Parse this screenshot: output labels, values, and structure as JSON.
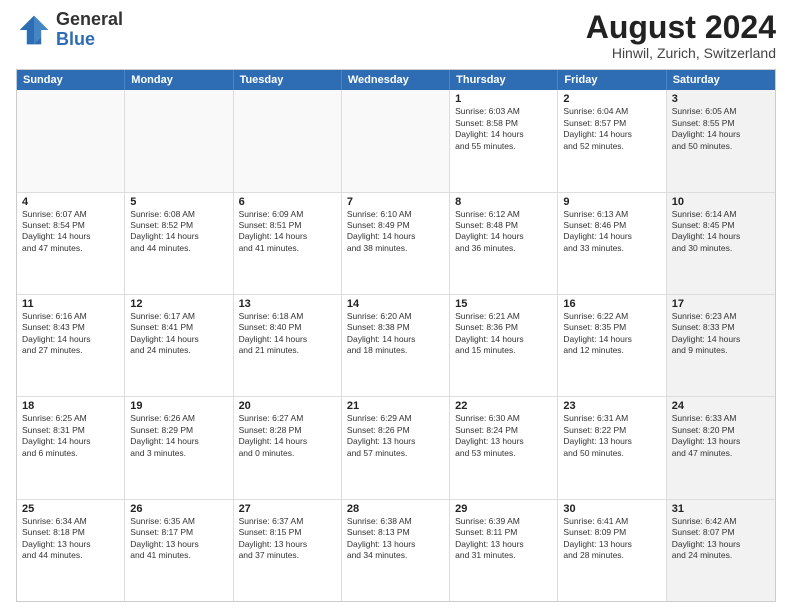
{
  "header": {
    "logo_general": "General",
    "logo_blue": "Blue",
    "month_title": "August 2024",
    "location": "Hinwil, Zurich, Switzerland"
  },
  "calendar": {
    "days_of_week": [
      "Sunday",
      "Monday",
      "Tuesday",
      "Wednesday",
      "Thursday",
      "Friday",
      "Saturday"
    ],
    "rows": [
      [
        {
          "day": "",
          "info": "",
          "empty": true
        },
        {
          "day": "",
          "info": "",
          "empty": true
        },
        {
          "day": "",
          "info": "",
          "empty": true
        },
        {
          "day": "",
          "info": "",
          "empty": true
        },
        {
          "day": "1",
          "info": "Sunrise: 6:03 AM\nSunset: 8:58 PM\nDaylight: 14 hours\nand 55 minutes.",
          "empty": false
        },
        {
          "day": "2",
          "info": "Sunrise: 6:04 AM\nSunset: 8:57 PM\nDaylight: 14 hours\nand 52 minutes.",
          "empty": false
        },
        {
          "day": "3",
          "info": "Sunrise: 6:05 AM\nSunset: 8:55 PM\nDaylight: 14 hours\nand 50 minutes.",
          "empty": false,
          "shaded": true
        }
      ],
      [
        {
          "day": "4",
          "info": "Sunrise: 6:07 AM\nSunset: 8:54 PM\nDaylight: 14 hours\nand 47 minutes.",
          "empty": false
        },
        {
          "day": "5",
          "info": "Sunrise: 6:08 AM\nSunset: 8:52 PM\nDaylight: 14 hours\nand 44 minutes.",
          "empty": false
        },
        {
          "day": "6",
          "info": "Sunrise: 6:09 AM\nSunset: 8:51 PM\nDaylight: 14 hours\nand 41 minutes.",
          "empty": false
        },
        {
          "day": "7",
          "info": "Sunrise: 6:10 AM\nSunset: 8:49 PM\nDaylight: 14 hours\nand 38 minutes.",
          "empty": false
        },
        {
          "day": "8",
          "info": "Sunrise: 6:12 AM\nSunset: 8:48 PM\nDaylight: 14 hours\nand 36 minutes.",
          "empty": false
        },
        {
          "day": "9",
          "info": "Sunrise: 6:13 AM\nSunset: 8:46 PM\nDaylight: 14 hours\nand 33 minutes.",
          "empty": false
        },
        {
          "day": "10",
          "info": "Sunrise: 6:14 AM\nSunset: 8:45 PM\nDaylight: 14 hours\nand 30 minutes.",
          "empty": false,
          "shaded": true
        }
      ],
      [
        {
          "day": "11",
          "info": "Sunrise: 6:16 AM\nSunset: 8:43 PM\nDaylight: 14 hours\nand 27 minutes.",
          "empty": false
        },
        {
          "day": "12",
          "info": "Sunrise: 6:17 AM\nSunset: 8:41 PM\nDaylight: 14 hours\nand 24 minutes.",
          "empty": false
        },
        {
          "day": "13",
          "info": "Sunrise: 6:18 AM\nSunset: 8:40 PM\nDaylight: 14 hours\nand 21 minutes.",
          "empty": false
        },
        {
          "day": "14",
          "info": "Sunrise: 6:20 AM\nSunset: 8:38 PM\nDaylight: 14 hours\nand 18 minutes.",
          "empty": false
        },
        {
          "day": "15",
          "info": "Sunrise: 6:21 AM\nSunset: 8:36 PM\nDaylight: 14 hours\nand 15 minutes.",
          "empty": false
        },
        {
          "day": "16",
          "info": "Sunrise: 6:22 AM\nSunset: 8:35 PM\nDaylight: 14 hours\nand 12 minutes.",
          "empty": false
        },
        {
          "day": "17",
          "info": "Sunrise: 6:23 AM\nSunset: 8:33 PM\nDaylight: 14 hours\nand 9 minutes.",
          "empty": false,
          "shaded": true
        }
      ],
      [
        {
          "day": "18",
          "info": "Sunrise: 6:25 AM\nSunset: 8:31 PM\nDaylight: 14 hours\nand 6 minutes.",
          "empty": false
        },
        {
          "day": "19",
          "info": "Sunrise: 6:26 AM\nSunset: 8:29 PM\nDaylight: 14 hours\nand 3 minutes.",
          "empty": false
        },
        {
          "day": "20",
          "info": "Sunrise: 6:27 AM\nSunset: 8:28 PM\nDaylight: 14 hours\nand 0 minutes.",
          "empty": false
        },
        {
          "day": "21",
          "info": "Sunrise: 6:29 AM\nSunset: 8:26 PM\nDaylight: 13 hours\nand 57 minutes.",
          "empty": false
        },
        {
          "day": "22",
          "info": "Sunrise: 6:30 AM\nSunset: 8:24 PM\nDaylight: 13 hours\nand 53 minutes.",
          "empty": false
        },
        {
          "day": "23",
          "info": "Sunrise: 6:31 AM\nSunset: 8:22 PM\nDaylight: 13 hours\nand 50 minutes.",
          "empty": false
        },
        {
          "day": "24",
          "info": "Sunrise: 6:33 AM\nSunset: 8:20 PM\nDaylight: 13 hours\nand 47 minutes.",
          "empty": false,
          "shaded": true
        }
      ],
      [
        {
          "day": "25",
          "info": "Sunrise: 6:34 AM\nSunset: 8:18 PM\nDaylight: 13 hours\nand 44 minutes.",
          "empty": false
        },
        {
          "day": "26",
          "info": "Sunrise: 6:35 AM\nSunset: 8:17 PM\nDaylight: 13 hours\nand 41 minutes.",
          "empty": false
        },
        {
          "day": "27",
          "info": "Sunrise: 6:37 AM\nSunset: 8:15 PM\nDaylight: 13 hours\nand 37 minutes.",
          "empty": false
        },
        {
          "day": "28",
          "info": "Sunrise: 6:38 AM\nSunset: 8:13 PM\nDaylight: 13 hours\nand 34 minutes.",
          "empty": false
        },
        {
          "day": "29",
          "info": "Sunrise: 6:39 AM\nSunset: 8:11 PM\nDaylight: 13 hours\nand 31 minutes.",
          "empty": false
        },
        {
          "day": "30",
          "info": "Sunrise: 6:41 AM\nSunset: 8:09 PM\nDaylight: 13 hours\nand 28 minutes.",
          "empty": false
        },
        {
          "day": "31",
          "info": "Sunrise: 6:42 AM\nSunset: 8:07 PM\nDaylight: 13 hours\nand 24 minutes.",
          "empty": false,
          "shaded": true
        }
      ]
    ]
  }
}
